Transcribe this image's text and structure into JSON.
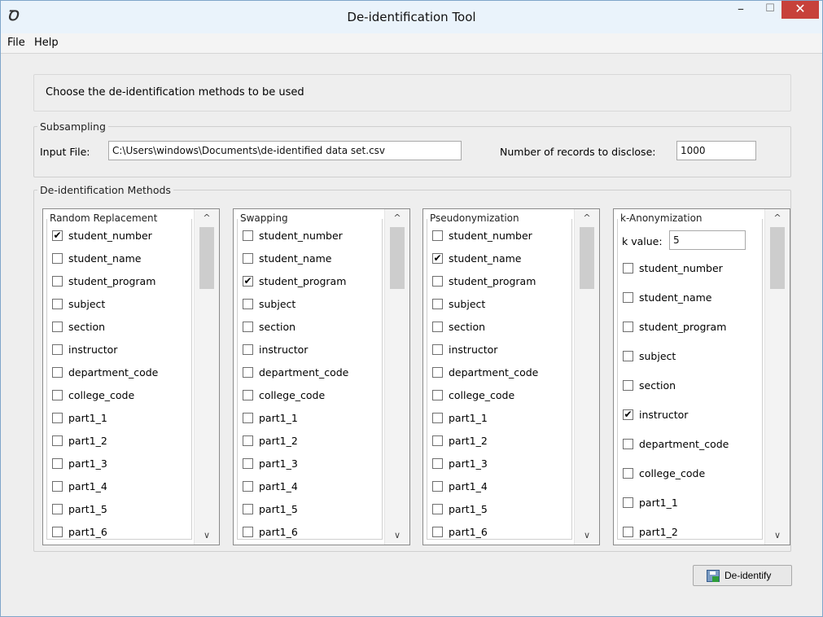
{
  "window": {
    "title": "De-identification Tool",
    "icon": "app-logo-icon",
    "minimize_glyph": "–",
    "maximize_glyph": "☐",
    "close_glyph": "✕"
  },
  "menu": {
    "items": [
      "File",
      "Help"
    ]
  },
  "header": {
    "instruction": "Choose the de-identification methods to be used"
  },
  "subsampling": {
    "legend": "Subsampling",
    "input_file_label": "Input File:",
    "input_file_value": "C:\\Users\\windows\\Documents\\de-identified data set.csv",
    "records_label": "Number of records to disclose:",
    "records_value": "1000"
  },
  "methods": {
    "legend": "De-identification Methods",
    "random_replacement": {
      "title": "Random Replacement",
      "items": [
        {
          "label": "student_number",
          "checked": true
        },
        {
          "label": "student_name",
          "checked": false
        },
        {
          "label": "student_program",
          "checked": false
        },
        {
          "label": "subject",
          "checked": false
        },
        {
          "label": "section",
          "checked": false
        },
        {
          "label": "instructor",
          "checked": false
        },
        {
          "label": "department_code",
          "checked": false
        },
        {
          "label": "college_code",
          "checked": false
        },
        {
          "label": "part1_1",
          "checked": false
        },
        {
          "label": "part1_2",
          "checked": false
        },
        {
          "label": "part1_3",
          "checked": false
        },
        {
          "label": "part1_4",
          "checked": false
        },
        {
          "label": "part1_5",
          "checked": false
        },
        {
          "label": "part1_6",
          "checked": false
        }
      ]
    },
    "swapping": {
      "title": "Swapping",
      "items": [
        {
          "label": "student_number",
          "checked": false
        },
        {
          "label": "student_name",
          "checked": false
        },
        {
          "label": "student_program",
          "checked": true
        },
        {
          "label": "subject",
          "checked": false
        },
        {
          "label": "section",
          "checked": false
        },
        {
          "label": "instructor",
          "checked": false
        },
        {
          "label": "department_code",
          "checked": false
        },
        {
          "label": "college_code",
          "checked": false
        },
        {
          "label": "part1_1",
          "checked": false
        },
        {
          "label": "part1_2",
          "checked": false
        },
        {
          "label": "part1_3",
          "checked": false
        },
        {
          "label": "part1_4",
          "checked": false
        },
        {
          "label": "part1_5",
          "checked": false
        },
        {
          "label": "part1_6",
          "checked": false
        }
      ]
    },
    "pseudonymization": {
      "title": "Pseudonymization",
      "items": [
        {
          "label": "student_number",
          "checked": false
        },
        {
          "label": "student_name",
          "checked": true
        },
        {
          "label": "student_program",
          "checked": false
        },
        {
          "label": "subject",
          "checked": false
        },
        {
          "label": "section",
          "checked": false
        },
        {
          "label": "instructor",
          "checked": false
        },
        {
          "label": "department_code",
          "checked": false
        },
        {
          "label": "college_code",
          "checked": false
        },
        {
          "label": "part1_1",
          "checked": false
        },
        {
          "label": "part1_2",
          "checked": false
        },
        {
          "label": "part1_3",
          "checked": false
        },
        {
          "label": "part1_4",
          "checked": false
        },
        {
          "label": "part1_5",
          "checked": false
        },
        {
          "label": "part1_6",
          "checked": false
        }
      ]
    },
    "k_anonymization": {
      "title": "k-Anonymization",
      "k_label": "k value:",
      "k_value": "5",
      "items": [
        {
          "label": "student_number",
          "checked": false
        },
        {
          "label": "student_name",
          "checked": false
        },
        {
          "label": "student_program",
          "checked": false
        },
        {
          "label": "subject",
          "checked": false
        },
        {
          "label": "section",
          "checked": false
        },
        {
          "label": "instructor",
          "checked": true
        },
        {
          "label": "department_code",
          "checked": false
        },
        {
          "label": "college_code",
          "checked": false
        },
        {
          "label": "part1_1",
          "checked": false
        },
        {
          "label": "part1_2",
          "checked": false
        }
      ]
    }
  },
  "actions": {
    "deidentify_label": "De-identify",
    "deidentify_icon": "save-icon"
  }
}
